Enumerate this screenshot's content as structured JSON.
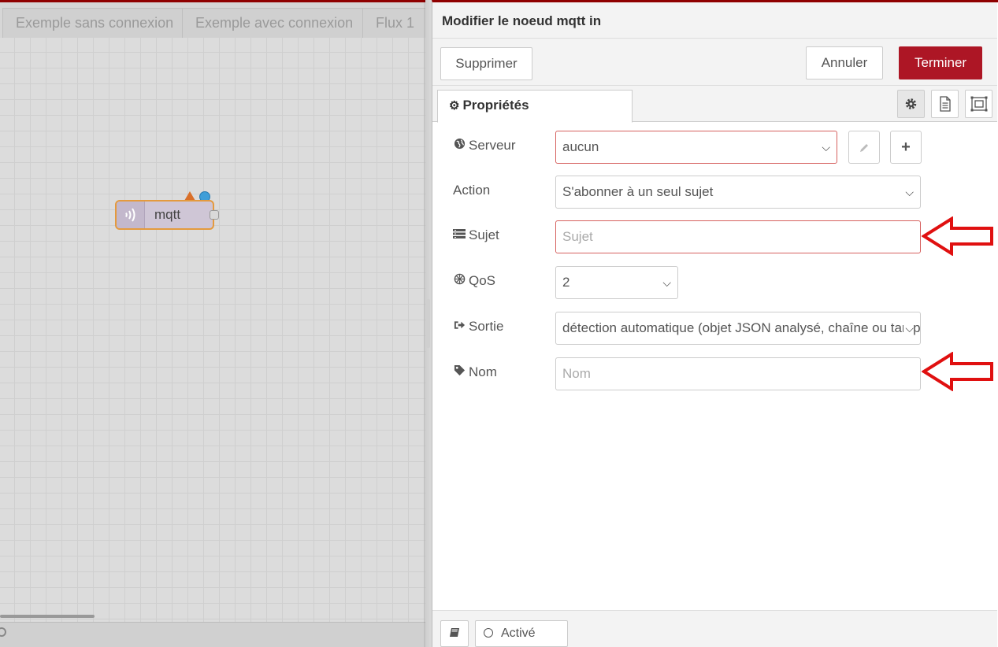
{
  "workspace": {
    "tabs": [
      {
        "label": "Exemple sans connexion"
      },
      {
        "label": "Exemple avec connexion"
      },
      {
        "label": "Flux 1"
      }
    ],
    "node": {
      "label": "mqtt",
      "icon": "wifi-icon",
      "accent": "#e49a3e"
    }
  },
  "tray": {
    "title": "Modifier le noeud mqtt in",
    "buttons": {
      "delete": "Supprimer",
      "cancel": "Annuler",
      "done": "Terminer"
    },
    "tab": {
      "label": "Propriétés"
    },
    "fields": {
      "server": {
        "label": "Serveur",
        "value": "aucun"
      },
      "action": {
        "label": "Action",
        "value": "S'abonner à un seul sujet"
      },
      "topic": {
        "label": "Sujet",
        "placeholder": "Sujet"
      },
      "qos": {
        "label": "QoS",
        "value": "2"
      },
      "output": {
        "label": "Sortie",
        "value": "détection automatique (objet JSON analysé, chaîne ou tampon)"
      },
      "name": {
        "label": "Nom",
        "placeholder": "Nom"
      }
    },
    "footer": {
      "enabled": "Activé"
    }
  },
  "colors": {
    "primary": "#ad1625",
    "invalid_border": "#d6615f",
    "annotation_arrow": "#e01010"
  }
}
